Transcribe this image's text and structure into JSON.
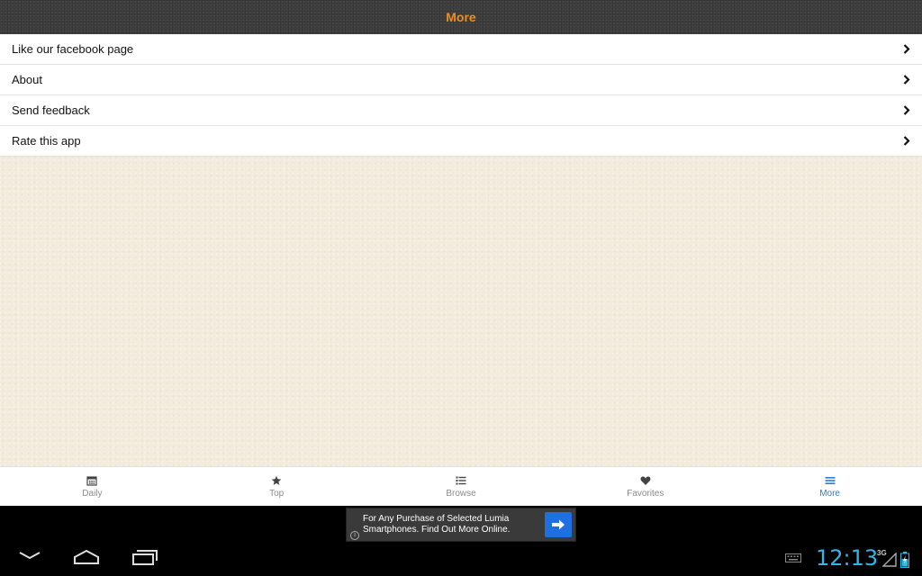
{
  "header": {
    "title": "More"
  },
  "menu": {
    "items": [
      {
        "label": "Like our facebook page"
      },
      {
        "label": "About"
      },
      {
        "label": "Send feedback"
      },
      {
        "label": "Rate this app"
      }
    ]
  },
  "tabs": [
    {
      "label": "Daily",
      "icon": "calendar-icon",
      "active": false
    },
    {
      "label": "Top",
      "icon": "star-icon",
      "active": false
    },
    {
      "label": "Browse",
      "icon": "list-icon",
      "active": false
    },
    {
      "label": "Favorites",
      "icon": "heart-icon",
      "active": false
    },
    {
      "label": "More",
      "icon": "menu-icon",
      "active": true
    }
  ],
  "ad": {
    "text": "For Any Purchase of Selected Lumia Smartphones. Find Out More Online."
  },
  "status": {
    "time": "12:13",
    "network": "3G"
  },
  "colors": {
    "accent": "#f0901a",
    "active_tab": "#2b7bd3",
    "clock": "#33b5e5",
    "ad_button": "#1f6fe0"
  }
}
